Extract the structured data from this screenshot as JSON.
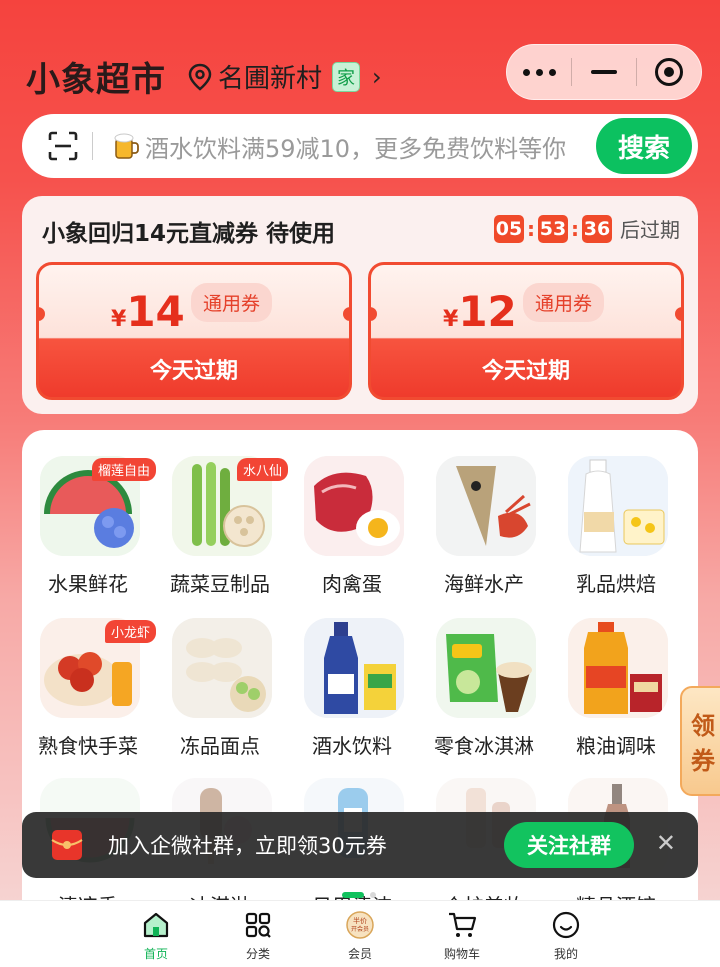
{
  "header": {
    "brand": "小象超市",
    "location": "名圃新村",
    "location_tag": "家",
    "chevron": "›"
  },
  "search": {
    "placeholder": "酒水饮料满59减10，更多免费饮料等你",
    "button_label": "搜索"
  },
  "coupons": {
    "title": "小象回归14元直减券 待使用",
    "timer": {
      "h": "05",
      "m": "53",
      "s": "36",
      "suffix": "后过期",
      "sep": ":"
    },
    "items": [
      {
        "currency": "¥",
        "amount": "14",
        "kind": "通用券",
        "expire": "今天过期"
      },
      {
        "currency": "¥",
        "amount": "12",
        "kind": "通用券",
        "expire": "今天过期"
      }
    ]
  },
  "categories": {
    "row1": [
      {
        "label": "水果鲜花",
        "badge": "榴莲自由"
      },
      {
        "label": "蔬菜豆制品",
        "badge": "水八仙"
      },
      {
        "label": "肉禽蛋",
        "badge": ""
      },
      {
        "label": "海鲜水产",
        "badge": ""
      },
      {
        "label": "乳品烘焙",
        "badge": ""
      }
    ],
    "row2": [
      {
        "label": "熟食快手菜",
        "badge": "小龙虾"
      },
      {
        "label": "冻品面点",
        "badge": ""
      },
      {
        "label": "酒水饮料",
        "badge": ""
      },
      {
        "label": "零食冰淇淋",
        "badge": ""
      },
      {
        "label": "粮油调味",
        "badge": ""
      }
    ],
    "row3": [
      {
        "label": "清凉季"
      },
      {
        "label": "冰淇淋"
      },
      {
        "label": "日用清洁"
      },
      {
        "label": "个护美妆"
      },
      {
        "label": "精品酒馆"
      }
    ]
  },
  "float_coupon": {
    "line1": "领",
    "line2": "券"
  },
  "join_banner": {
    "text": "加入企微社群，立即领30元券",
    "button": "关注社群",
    "close": "✕"
  },
  "tabbar": {
    "items": [
      {
        "label": "首页",
        "icon": "home-icon",
        "active": true
      },
      {
        "label": "分类",
        "icon": "category-icon",
        "active": false
      },
      {
        "label": "会员",
        "icon": "member-icon",
        "active": false,
        "icon_text": "开会员",
        "icon_text_top": "半价"
      },
      {
        "label": "购物车",
        "icon": "cart-icon",
        "active": false
      },
      {
        "label": "我的",
        "icon": "profile-icon",
        "active": false
      }
    ]
  },
  "colors": {
    "primary_green": "#0cc160",
    "coupon_red": "#f04a2a",
    "background_red": "#f5433e"
  }
}
